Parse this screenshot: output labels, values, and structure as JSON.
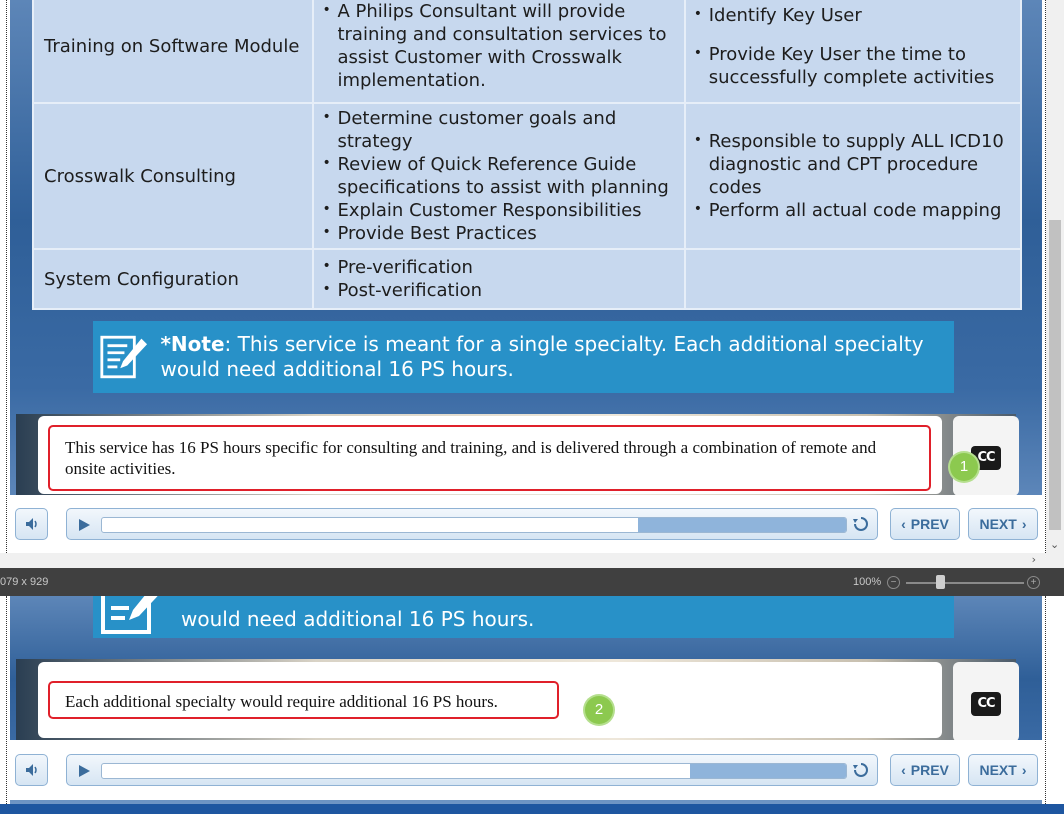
{
  "table": {
    "rows": [
      {
        "col1": "Training on Software Module",
        "col2": [
          "A Philips Consultant will provide training and consultation services to assist Customer with Crosswalk implementation."
        ],
        "col3": [
          "Identify Key User",
          "Provide Key User the time to successfully complete activities"
        ]
      },
      {
        "col1": "Crosswalk Consulting",
        "col2": [
          "Determine customer goals and strategy",
          "Review of Quick Reference Guide specifications to assist with planning",
          "Explain Customer Responsibilities",
          "Provide Best Practices"
        ],
        "col3": [
          "Responsible to supply ALL ICD10 diagnostic and CPT procedure codes",
          "Perform all actual code mapping"
        ]
      },
      {
        "col1": "System Configuration",
        "col2": [
          "Pre-verification",
          "Post-verification"
        ],
        "col3": []
      }
    ]
  },
  "note": {
    "label": "*Note",
    "text": ": This service is meant for a single specialty. Each additional specialty would need additional 16 PS hours.",
    "line2": "would need additional 16 PS hours."
  },
  "captions": {
    "top": "This service has 16 PS hours specific for consulting and training, and is delivered through a combination of remote and onsite activities.",
    "bottom": "Each additional specialty would require additional 16 PS hours."
  },
  "markers": {
    "top": "1",
    "bottom": "2"
  },
  "cc_label": "CC",
  "player": {
    "prev_label": "PREV",
    "next_label": "NEXT",
    "progress_top": 0.72,
    "progress_bottom": 0.79
  },
  "status": {
    "dimensions": "079 x 929",
    "zoom": "100%"
  },
  "colors": {
    "note_bg": "#2891c8",
    "caption_border": "#e0202a",
    "marker": "#8cc94f",
    "accent_blue": "#3b6c9c"
  }
}
